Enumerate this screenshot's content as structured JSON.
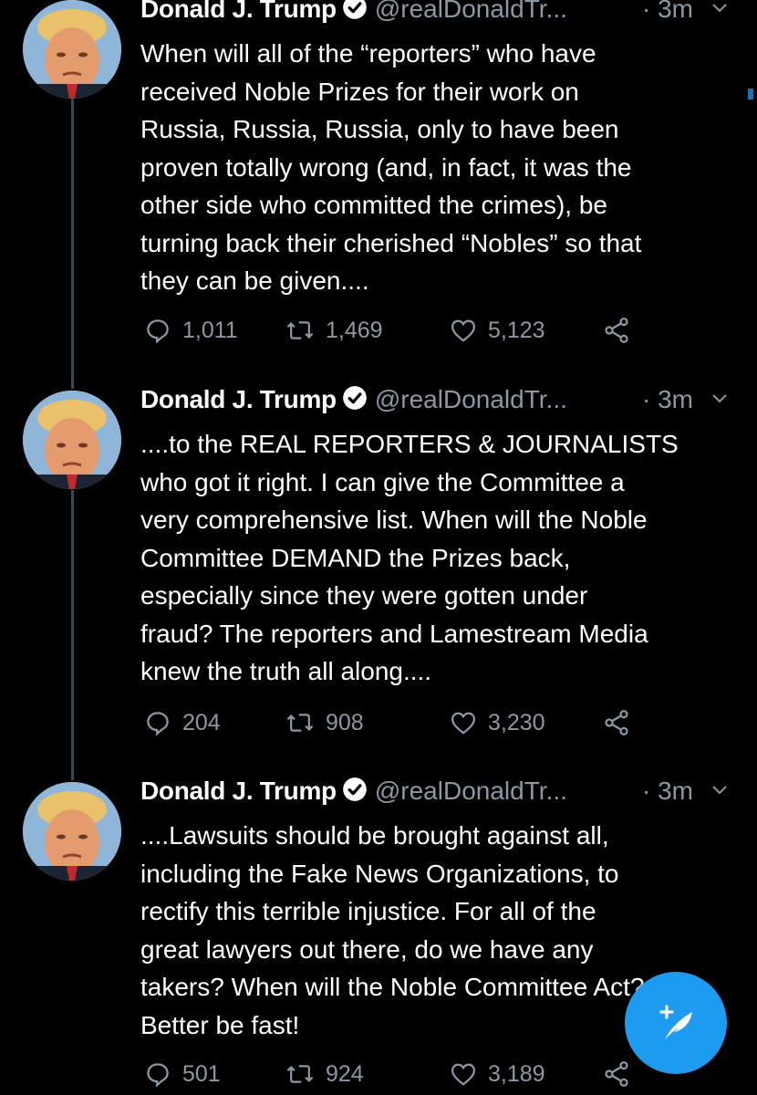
{
  "tweets": [
    {
      "name": "Donald J. Trump",
      "handle": "@realDonaldTr...",
      "time": "· 3m",
      "text": "When will all of the “reporters” who have\nreceived Noble Prizes for their work on\nRussia, Russia, Russia, only to have been\nproven totally wrong (and, in fact, it was the\nother side who committed the crimes), be\nturning back their cherished “Nobles” so that\nthey can be given....",
      "replies": "1,011",
      "retweets": "1,469",
      "likes": "5,123"
    },
    {
      "name": "Donald J. Trump",
      "handle": "@realDonaldTr...",
      "time": "· 3m",
      "text": "....to the REAL REPORTERS & JOURNALISTS\nwho got it right. I can give the Committee a\nvery comprehensive list. When will the Noble\nCommittee DEMAND the Prizes back,\nespecially since they were gotten under\nfraud? The reporters and Lamestream Media\nknew the truth all along....",
      "replies": "204",
      "retweets": "908",
      "likes": "3,230"
    },
    {
      "name": "Donald J. Trump",
      "handle": "@realDonaldTr...",
      "time": "· 3m",
      "text": "....Lawsuits should be brought against all,\nincluding the Fake News Organizations, to\nrectify this terrible injustice. For all of the\ngreat lawyers out there, do we have any\ntakers? When will the Noble Committee Act?\nBetter be fast!",
      "replies": "501",
      "retweets": "924",
      "likes": "3,189"
    }
  ],
  "icons": {
    "verified": "verified-badge-icon",
    "reply": "reply-icon",
    "retweet": "retweet-icon",
    "like": "heart-icon",
    "share": "share-icon",
    "chevron": "chevron-down-icon",
    "compose": "compose-tweet-icon"
  },
  "colors": {
    "background": "#000000",
    "text": "#ffffff",
    "secondary": "#8b98a5",
    "accent": "#1d9bf0"
  }
}
